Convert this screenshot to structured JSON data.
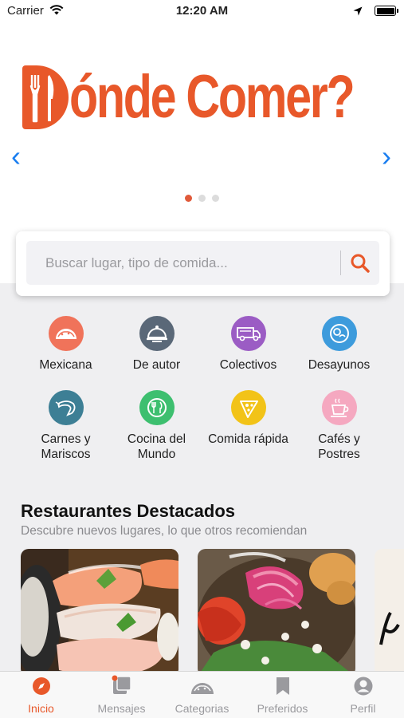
{
  "status_bar": {
    "carrier": "Carrier",
    "time": "12:20 AM"
  },
  "hero": {
    "logo_text": "ónde Comer?",
    "logo_alt": "Dónde Comer?",
    "prev_arrow": "‹",
    "next_arrow": "›",
    "slides_total": 3,
    "active_slide": 1
  },
  "search": {
    "placeholder": "Buscar lugar, tipo de comida..."
  },
  "categories": [
    {
      "label": "Mexicana",
      "icon": "taco-icon",
      "color": "#f0735a"
    },
    {
      "label": "De autor",
      "icon": "cloche-icon",
      "color": "#5a6878"
    },
    {
      "label": "Colectivos",
      "icon": "food-truck-icon",
      "color": "#9b5cc4"
    },
    {
      "label": "Desayunos",
      "icon": "breakfast-plate-icon",
      "color": "#3d9bdc"
    },
    {
      "label": "Carnes y\nMariscos",
      "icon": "shrimp-icon",
      "color": "#3d7f95"
    },
    {
      "label": "Cocina del\nMundo",
      "icon": "world-cuisine-icon",
      "color": "#3dbf6f"
    },
    {
      "label": "Comida rápida",
      "icon": "pizza-slice-icon",
      "color": "#f2c318"
    },
    {
      "label": "Cafés y\nPostres",
      "icon": "coffee-cup-icon",
      "color": "#f5a8c0"
    }
  ],
  "featured": {
    "title": "Restaurantes Destacados",
    "subtitle": "Descubre nuevos lugares, lo que otros recomiendan",
    "cards": [
      {
        "image": "sushi-photo"
      },
      {
        "image": "tostada-photo"
      },
      {
        "image": "sign-photo"
      }
    ]
  },
  "tabs": [
    {
      "label": "Inicio",
      "icon": "compass-icon",
      "active": true
    },
    {
      "label": "Mensajes",
      "icon": "messages-icon",
      "active": false
    },
    {
      "label": "Categorias",
      "icon": "taco-outline-icon",
      "active": false
    },
    {
      "label": "Preferidos",
      "icon": "bookmark-icon",
      "active": false
    },
    {
      "label": "Perfil",
      "icon": "user-icon",
      "active": false
    }
  ],
  "colors": {
    "brand": "#e8582a",
    "link": "#1a7ef0",
    "inactive": "#9a9a9e"
  }
}
